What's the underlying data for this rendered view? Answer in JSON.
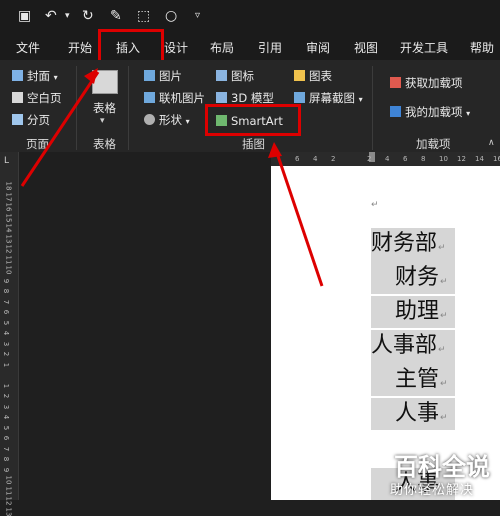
{
  "quick_access": {
    "save_icon": "save-icon",
    "undo_icon": "undo-icon",
    "redo_icon": "redo-icon",
    "format_painter_icon": "format-painter-icon",
    "select_icon": "select-icon",
    "circle_icon": "circle-icon",
    "customize_icon": "chevron-down-icon"
  },
  "tabs": [
    "文件",
    "开始",
    "插入",
    "设计",
    "布局",
    "引用",
    "审阅",
    "视图",
    "开发工具",
    "帮助"
  ],
  "ribbon": {
    "pages_group": {
      "cover": "封面",
      "blank_page": "空白页",
      "page_break": "分页",
      "label": "页面"
    },
    "tables_group": {
      "table": "表格",
      "label": "表格"
    },
    "illustrations_group": {
      "pictures": "图片",
      "online_pictures": "联机图片",
      "shapes": "形状",
      "icons": "图标",
      "models_3d": "3D 模型",
      "smartart": "SmartArt",
      "chart": "图表",
      "screenshot": "屏幕截图",
      "label": "插图"
    },
    "addins_group": {
      "get_addins": "获取加载项",
      "my_addins": "我的加载项",
      "label": "加载项"
    }
  },
  "vertical_ruler": [
    "18",
    "17",
    "16",
    "15",
    "14",
    "13",
    "12",
    "11",
    "10",
    "9",
    "8",
    "7",
    "6",
    "5",
    "4",
    "3",
    "2",
    "1",
    "",
    "1",
    "2",
    "3",
    "4",
    "5",
    "6",
    "7",
    "8",
    "9",
    "10",
    "11",
    "12",
    "13"
  ],
  "horizontal_ruler": [
    "6",
    "4",
    "2",
    "",
    "2",
    "4",
    "6",
    "8",
    "10",
    "12",
    "14",
    "16"
  ],
  "document_lines": [
    "财务部",
    "财务",
    "助理",
    "人事部",
    "主管",
    "人事",
    "人事"
  ],
  "watermark": {
    "logo": "百科全说",
    "sub": "助你轻松解决"
  },
  "colors": {
    "highlight_box": "#dd0000",
    "ribbon_bg": "#262626",
    "page_bg": "#ffffff"
  }
}
